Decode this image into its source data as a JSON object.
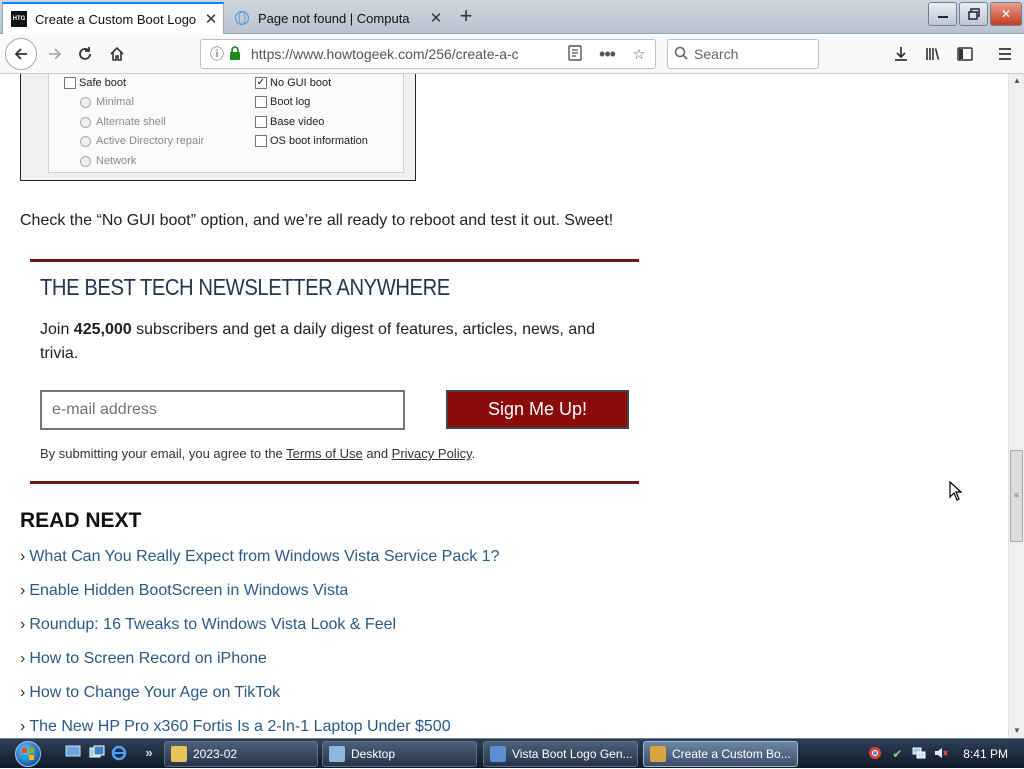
{
  "browser": {
    "tabs": [
      {
        "title": "Create a Custom Boot Logo for",
        "active": true
      },
      {
        "title": "Page not found | Computa",
        "active": false
      }
    ],
    "new_tab_label": "+",
    "url": "https://www.howtogeek.com/256/create-a-c",
    "search_placeholder": "Search"
  },
  "article": {
    "boot_options": {
      "left": [
        {
          "label": "Safe boot",
          "kind": "checkbox",
          "checked": false,
          "disabled": false
        },
        {
          "label": "Minimal",
          "kind": "radio",
          "disabled": true
        },
        {
          "label": "Alternate shell",
          "kind": "radio",
          "disabled": true
        },
        {
          "label": "Active Directory repair",
          "kind": "radio",
          "disabled": true
        },
        {
          "label": "Network",
          "kind": "radio",
          "disabled": true
        }
      ],
      "right": [
        {
          "label": "No GUI boot",
          "kind": "checkbox",
          "checked": true
        },
        {
          "label": "Boot log",
          "kind": "checkbox",
          "checked": false
        },
        {
          "label": "Base video",
          "kind": "checkbox",
          "checked": false
        },
        {
          "label": "OS boot information",
          "kind": "checkbox",
          "checked": false
        }
      ]
    },
    "paragraph": "Check the “No GUI boot” option, and we’re all ready to reboot and test it out. Sweet!"
  },
  "newsletter": {
    "title": "THE BEST TECH NEWSLETTER ANYWHERE",
    "desc_prefix": "Join ",
    "subscribers": "425,000",
    "desc_suffix": " subscribers and get a daily digest of features, articles, news, and trivia.",
    "email_placeholder": "e-mail address",
    "button_label": "Sign Me Up!",
    "legal_prefix": "By submitting your email, you agree to the ",
    "terms_link": "Terms of Use",
    "legal_and": " and ",
    "privacy_link": "Privacy Policy",
    "legal_suffix": "."
  },
  "read_next": {
    "heading": "READ NEXT",
    "chevron": "›",
    "items": [
      "What Can You Really Expect from Windows Vista Service Pack 1?",
      "Enable Hidden BootScreen in Windows Vista",
      "Roundup: 16 Tweaks to Windows Vista Look & Feel",
      "How to Screen Record on iPhone",
      "How to Change Your Age on TikTok",
      "The New HP Pro x360 Fortis Is a 2-In-1 Laptop Under $500"
    ]
  },
  "taskbar": {
    "tasks": [
      {
        "label": "2023-02",
        "active": false
      },
      {
        "label": "Desktop",
        "active": false
      },
      {
        "label": "Vista Boot Logo Gen...",
        "active": false
      },
      {
        "label": "Create a Custom Bo...",
        "active": true
      }
    ],
    "quicklaunch_more": "»",
    "clock": "8:41 PM"
  },
  "colors": {
    "link": "#2b5a86",
    "newsletter_border": "#6d1717",
    "signup_button": "#8b0a0a",
    "newsletter_title": "#26374d"
  }
}
